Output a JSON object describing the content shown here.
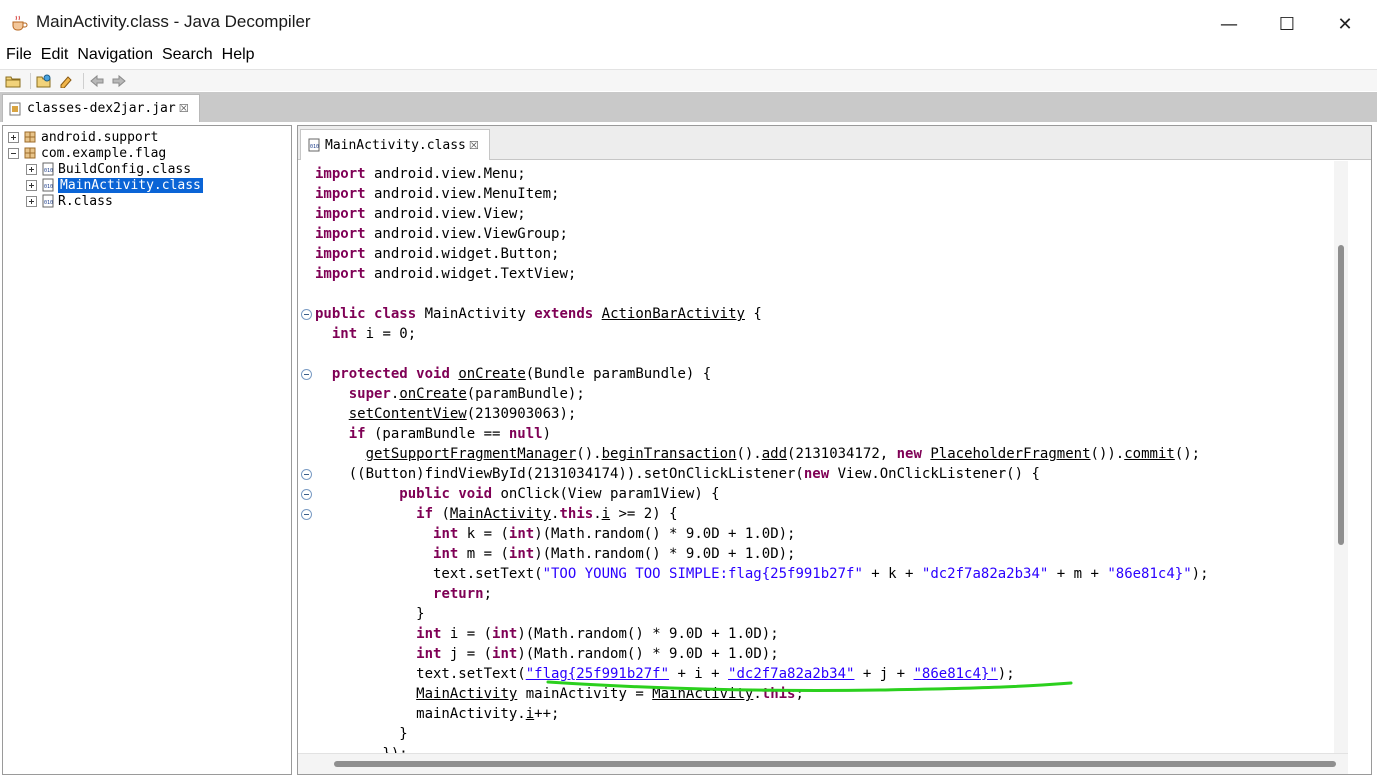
{
  "window": {
    "title": "MainActivity.class - Java Decompiler",
    "minimize": "—",
    "maximize": "☐",
    "close": "✕"
  },
  "menu": {
    "items": [
      "File",
      "Edit",
      "Navigation",
      "Search",
      "Help"
    ]
  },
  "toolbar": {
    "icons": [
      "open-file-icon",
      "open-folder-icon",
      "edit-icon",
      "back-icon",
      "forward-icon"
    ]
  },
  "file_tab": {
    "label": "classes-dex2jar.jar",
    "close": "☒"
  },
  "tree": {
    "items": [
      {
        "label": "android.support",
        "type": "package"
      },
      {
        "label": "com.example.flag",
        "type": "package"
      },
      {
        "label": "BuildConfig.class",
        "type": "class"
      },
      {
        "label": "MainActivity.class",
        "type": "class",
        "selected": true
      },
      {
        "label": "R.class",
        "type": "class"
      }
    ]
  },
  "editor": {
    "tab_label": "MainActivity.class",
    "tab_close": "☒",
    "code": [
      "import android.view.Menu;",
      "import android.view.MenuItem;",
      "import android.view.View;",
      "import android.view.ViewGroup;",
      "import android.widget.Button;",
      "import android.widget.TextView;",
      "",
      "public class MainActivity extends ActionBarActivity {",
      "  int i = 0;",
      "",
      "  protected void onCreate(Bundle paramBundle) {",
      "    super.onCreate(paramBundle);",
      "    setContentView(2130903063);",
      "    if (paramBundle == null)",
      "      getSupportFragmentManager().beginTransaction().add(2131034172, new PlaceholderFragment()).commit();",
      "    ((Button)findViewById(2131034174)).setOnClickListener(new View.OnClickListener() {",
      "          public void onClick(View param1View) {",
      "            if (MainActivity.this.i >= 2) {",
      "              int k = (int)(Math.random() * 9.0D + 1.0D);",
      "              int m = (int)(Math.random() * 9.0D + 1.0D);",
      "              text.setText(\"TOO YOUNG TOO SIMPLE:flag{25f991b27f\" + k + \"dc2f7a82a2b34\" + m + \"86e81c4}\");",
      "              return;",
      "            }",
      "            int i = (int)(Math.random() * 9.0D + 1.0D);",
      "            int j = (int)(Math.random() * 9.0D + 1.0D);",
      "            text.setText(\"flag{25f991b27f\" + i + \"dc2f7a82a2b34\" + j + \"86e81c4}\");",
      "            MainActivity mainActivity = MainActivity.this;",
      "            mainActivity.i++;",
      "          }",
      "        });"
    ]
  },
  "colors": {
    "keyword": "#7f0055",
    "string": "#2a00ff",
    "selection": "#0a64d6",
    "annotation_stroke": "#2bd01e"
  }
}
